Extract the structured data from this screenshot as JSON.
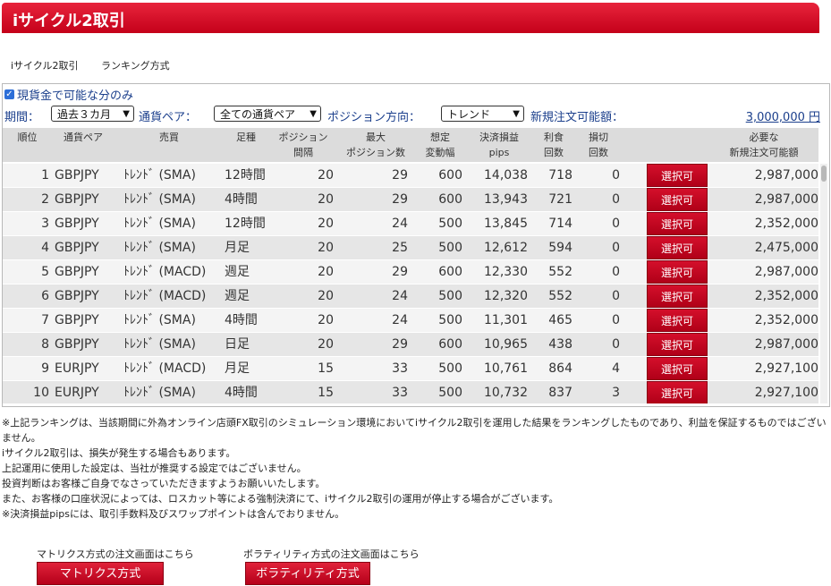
{
  "header": {
    "title": "iサイクル2取引"
  },
  "subnav": [
    "iサイクル2取引",
    "ランキング方式"
  ],
  "filter": {
    "cash_only_label": "現貨金で可能な分のみ",
    "period_label": "期間：",
    "period_value": "過去３カ月",
    "pair_label": "通貨ペア：",
    "pair_value": "全ての通貨ペア",
    "direction_label": "ポジション方向：",
    "direction_value": "トレンド",
    "margin_label": "新規注文可能額：",
    "margin_value": "3,000,000 円"
  },
  "table": {
    "headers": {
      "rank": "順位",
      "pair": "通貨ペア",
      "trade": "売買",
      "timeframe": "足種",
      "pos_interval_1": "ポジション",
      "pos_interval_2": "間隔",
      "max_pos_1": "最大",
      "max_pos_2": "ポジション数",
      "range_1": "想定",
      "range_2": "変動幅",
      "pl_1": "決済損益",
      "pl_2": "pips",
      "profit_1": "利食",
      "profit_2": "回数",
      "loss_1": "損切",
      "loss_2": "回数",
      "req_1": "必要な",
      "req_2": "新規注文可能額"
    },
    "button_label": "選択可",
    "rows": [
      {
        "rank": "1",
        "pair": "GBPJPY",
        "trade": "ﾄﾚﾝﾄﾞ (SMA)",
        "tf": "12時間",
        "interval": "20",
        "max": "29",
        "range": "600",
        "pips": "14,038",
        "profit": "718",
        "loss": "0",
        "req": "2,987,000"
      },
      {
        "rank": "2",
        "pair": "GBPJPY",
        "trade": "ﾄﾚﾝﾄﾞ (SMA)",
        "tf": "4時間",
        "interval": "20",
        "max": "29",
        "range": "600",
        "pips": "13,943",
        "profit": "721",
        "loss": "0",
        "req": "2,987,000"
      },
      {
        "rank": "3",
        "pair": "GBPJPY",
        "trade": "ﾄﾚﾝﾄﾞ (SMA)",
        "tf": "12時間",
        "interval": "20",
        "max": "24",
        "range": "500",
        "pips": "13,845",
        "profit": "714",
        "loss": "0",
        "req": "2,352,000"
      },
      {
        "rank": "4",
        "pair": "GBPJPY",
        "trade": "ﾄﾚﾝﾄﾞ (SMA)",
        "tf": "月足",
        "interval": "20",
        "max": "25",
        "range": "500",
        "pips": "12,612",
        "profit": "594",
        "loss": "0",
        "req": "2,475,000"
      },
      {
        "rank": "5",
        "pair": "GBPJPY",
        "trade": "ﾄﾚﾝﾄﾞ (MACD)",
        "tf": "週足",
        "interval": "20",
        "max": "29",
        "range": "600",
        "pips": "12,330",
        "profit": "552",
        "loss": "0",
        "req": "2,987,000"
      },
      {
        "rank": "6",
        "pair": "GBPJPY",
        "trade": "ﾄﾚﾝﾄﾞ (MACD)",
        "tf": "週足",
        "interval": "20",
        "max": "24",
        "range": "500",
        "pips": "12,320",
        "profit": "552",
        "loss": "0",
        "req": "2,352,000"
      },
      {
        "rank": "7",
        "pair": "GBPJPY",
        "trade": "ﾄﾚﾝﾄﾞ (SMA)",
        "tf": "4時間",
        "interval": "20",
        "max": "24",
        "range": "500",
        "pips": "11,301",
        "profit": "465",
        "loss": "0",
        "req": "2,352,000"
      },
      {
        "rank": "8",
        "pair": "GBPJPY",
        "trade": "ﾄﾚﾝﾄﾞ (SMA)",
        "tf": "日足",
        "interval": "20",
        "max": "29",
        "range": "600",
        "pips": "10,965",
        "profit": "438",
        "loss": "0",
        "req": "2,987,000"
      },
      {
        "rank": "9",
        "pair": "EURJPY",
        "trade": "ﾄﾚﾝﾄﾞ (MACD)",
        "tf": "月足",
        "interval": "15",
        "max": "33",
        "range": "500",
        "pips": "10,761",
        "profit": "864",
        "loss": "4",
        "req": "2,927,100"
      },
      {
        "rank": "10",
        "pair": "EURJPY",
        "trade": "ﾄﾚﾝﾄﾞ (SMA)",
        "tf": "4時間",
        "interval": "15",
        "max": "33",
        "range": "500",
        "pips": "10,732",
        "profit": "837",
        "loss": "3",
        "req": "2,927,100"
      }
    ]
  },
  "notes": [
    "※上記ランキングは、当該期間に外為オンライン店頭FX取引のシミュレーション環境においてiサイクル2取引を運用した結果をランキングしたものであり、利益を保証するものではございません。",
    "iサイクル2取引は、損失が発生する場合もあります。",
    "上記運用に使用した設定は、当社が推奨する設定ではございません。",
    "投資判断はお客様ご自身でなさっていただきますようお願いいたします。",
    "また、お客様の口座状況によっては、ロスカット等による強制決済にて、iサイクル2取引の運用が停止する場合がございます。",
    "※決済損益pipsには、取引手数料及びスワップポイントは含んでおりません。"
  ],
  "footer": {
    "matrix_caption": "マトリクス方式の注文画面はこちら",
    "matrix_button": "マトリクス方式",
    "vol_caption": "ボラティリティ方式の注文画面はこちら",
    "vol_button": "ボラティリティ方式"
  },
  "colors": {
    "brand_red": "#c4001a",
    "link_blue": "#1b3f8c"
  }
}
